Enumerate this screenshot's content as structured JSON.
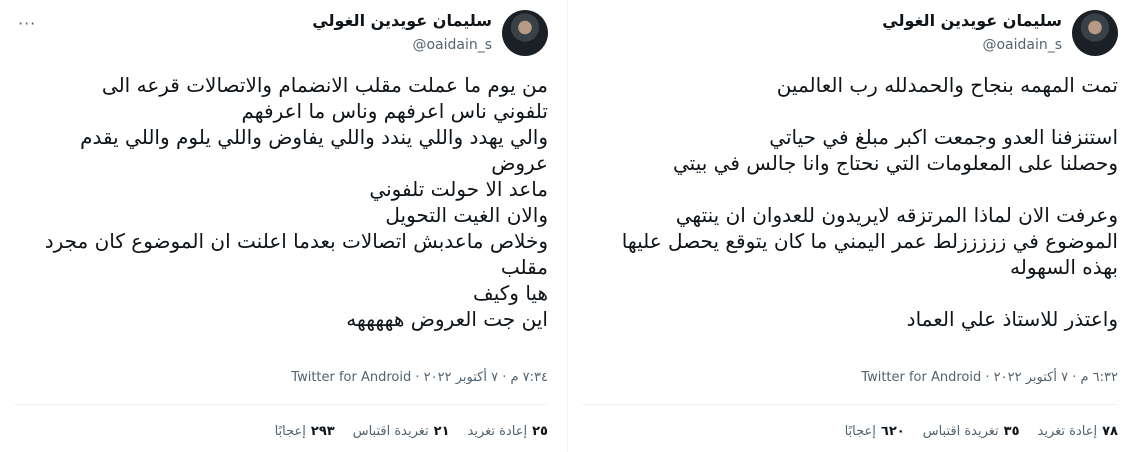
{
  "tweets": [
    {
      "author": {
        "name": "سليمان عويدين الغولي",
        "handle": "@oaidain_s"
      },
      "text": "تمت المهمه بنجاح والحمدلله رب العالمين\n\nاستنزفنا العدو وجمعت اكبر مبلغ في حياتي\nوحصلنا على المعلومات التي نحتاج وانا جالس في بيتي\n\nوعرفت الان لماذا المرتزقه لايريدون للعدوان ان ينتهي\nالموضوع في زززززلط عمر اليمني ما كان يتوقع يحصل عليها\nبهذه السهوله\n\nواعتذر للاستاذ علي العماد",
      "time": "٦:٣٢ م · ٧ أكتوبر ٢٠٢٢",
      "source": "Twitter for Android",
      "stats": {
        "retweets": {
          "value": "٧٨",
          "label": "إعادة تغريد"
        },
        "quotes": {
          "value": "٣٥",
          "label": "تغريدة اقتباس"
        },
        "likes": {
          "value": "٦٢٠",
          "label": "إعجابًا"
        }
      }
    },
    {
      "author": {
        "name": "سليمان عويدين الغولي",
        "handle": "@oaidain_s"
      },
      "text": "من يوم ما عملت مقلب الانضمام والاتصالات قرعه الى\nتلفوني ناس اعرفهم وناس ما اعرفهم\nوالي يهدد واللي يندد واللي يفاوض واللي يلوم واللي يقدم\nعروض\nماعد الا حولت تلفوني\nوالان الغيت التحويل\nوخلاص ماعدبش اتصالات بعدما اعلنت ان الموضوع كان مجرد\nمقلب\nهيا وكيف\nاين جت العروض هههههه",
      "time": "٧:٣٤ م · ٧ أكتوبر ٢٠٢٢",
      "source": "Twitter for Android",
      "stats": {
        "retweets": {
          "value": "٢٥",
          "label": "إعادة تغريد"
        },
        "quotes": {
          "value": "٢١",
          "label": "تغريدة اقتباس"
        },
        "likes": {
          "value": "٢٩٣",
          "label": "إعجابًا"
        }
      }
    }
  ],
  "icons": {
    "more": "more-options-icon"
  }
}
